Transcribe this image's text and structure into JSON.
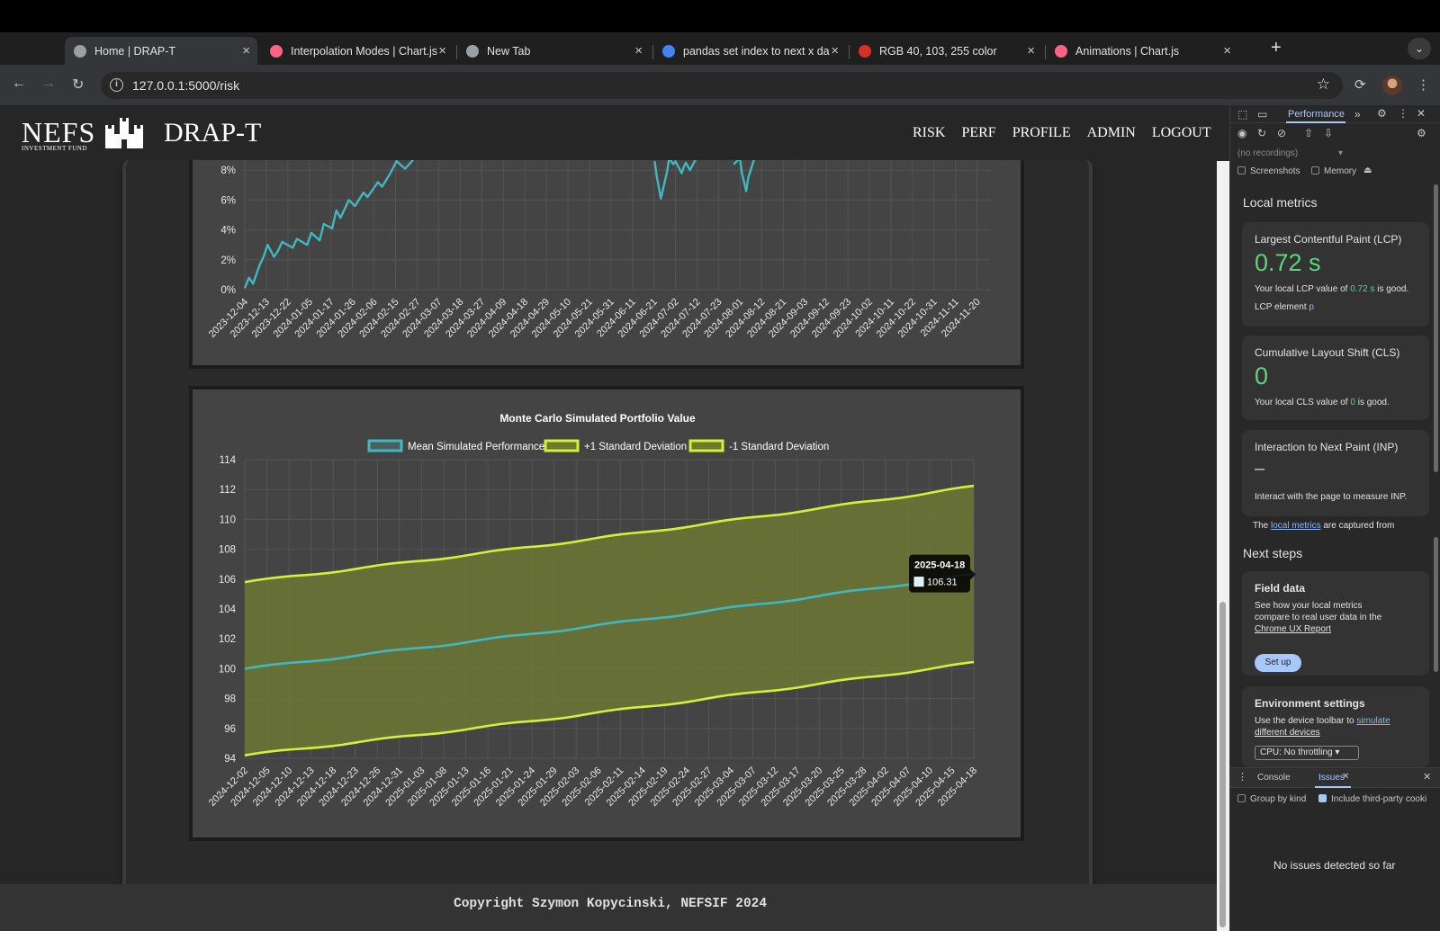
{
  "tabs": [
    {
      "title": "Home | DRAP-T",
      "fav": "#9aa0a6",
      "active": true
    },
    {
      "title": "Interpolation Modes | Chart.js",
      "fav": "#ff6384",
      "active": false
    },
    {
      "title": "New Tab",
      "fav": "#9aa0a6",
      "active": false
    },
    {
      "title": "pandas set index to next x da",
      "fav": "#4285f4",
      "active": false
    },
    {
      "title": "RGB 40, 103, 255 color",
      "fav": "#d93025",
      "active": false
    },
    {
      "title": "Animations | Chart.js",
      "fav": "#ff6384",
      "active": false
    }
  ],
  "toolbar": {
    "url": "127.0.0.1:5000/risk"
  },
  "site": {
    "logo_text": "NEFS",
    "logo_sub": "INVESTMENT FUND",
    "brand": "DRAP-T",
    "nav": [
      "RISK",
      "PERF",
      "PROFILE",
      "ADMIN",
      "LOGOUT"
    ],
    "footer": "Copyright Szymon Kopycinski, NEFSIF 2024"
  },
  "chart_data": [
    {
      "type": "line",
      "title": "",
      "y_tick_labels": [
        "0%",
        "2%",
        "4%",
        "6%",
        "8%"
      ],
      "x_tick_labels": [
        "2023-12-04",
        "2023-12-13",
        "2023-12-22",
        "2024-01-05",
        "2024-01-17",
        "2024-01-26",
        "2024-02-06",
        "2024-02-15",
        "2024-02-27",
        "2024-03-07",
        "2024-03-18",
        "2024-03-27",
        "2024-04-09",
        "2024-04-18",
        "2024-04-29",
        "2024-05-10",
        "2024-05-21",
        "2024-05-31",
        "2024-06-11",
        "2024-06-21",
        "2024-07-02",
        "2024-07-12",
        "2024-07-23",
        "2024-08-01",
        "2024-08-12",
        "2024-08-21",
        "2024-09-03",
        "2024-09-12",
        "2024-09-23",
        "2024-10-02",
        "2024-10-11",
        "2024-10-22",
        "2024-10-31",
        "2024-11-11",
        "2024-11-20"
      ],
      "color": "#3fb8c0",
      "grid": true,
      "series": [
        {
          "x": [
            "2023-12-04",
            "2023-12-06",
            "2023-12-08",
            "2023-12-11",
            "2023-12-13",
            "2023-12-15",
            "2023-12-18",
            "2023-12-20",
            "2023-12-22",
            "2023-12-27",
            "2023-12-29",
            "2024-01-03",
            "2024-01-05",
            "2024-01-09",
            "2024-01-11",
            "2024-01-15",
            "2024-01-17",
            "2024-01-19",
            "2024-01-23",
            "2024-01-26",
            "2024-01-30",
            "2024-02-01",
            "2024-02-06",
            "2024-02-08",
            "2024-02-12",
            "2024-02-15",
            "2024-02-19",
            "2024-02-23"
          ],
          "values": [
            0.1,
            0.8,
            0.4,
            1.6,
            2.2,
            3.0,
            2.2,
            2.6,
            3.2,
            2.8,
            3.4,
            3.0,
            3.8,
            3.3,
            4.4,
            4.1,
            5.3,
            4.8,
            6.0,
            5.6,
            6.5,
            6.2,
            7.2,
            6.9,
            7.8,
            8.6,
            8.1,
            8.7
          ]
        },
        {
          "x": [
            "2024-06-18",
            "2024-06-19",
            "2024-06-21",
            "2024-06-24",
            "2024-06-25",
            "2024-06-27",
            "2024-06-28",
            "2024-07-01",
            "2024-07-02",
            "2024-07-03",
            "2024-07-05",
            "2024-07-08"
          ],
          "values": [
            8.6,
            7.6,
            6.1,
            7.9,
            8.8,
            8.4,
            8.6,
            7.8,
            8.2,
            8.5,
            8.0,
            8.8
          ]
        },
        {
          "x": [
            "2024-07-26",
            "2024-07-29",
            "2024-07-30",
            "2024-08-01",
            "2024-08-02",
            "2024-08-05"
          ],
          "values": [
            8.4,
            8.8,
            7.8,
            6.6,
            7.5,
            8.8
          ]
        }
      ]
    },
    {
      "type": "area",
      "title": "Monte Carlo Simulated Portfolio Value",
      "legend_position": "top",
      "ylim": [
        94,
        114
      ],
      "y_ticks": [
        94,
        96,
        98,
        100,
        102,
        104,
        106,
        108,
        110,
        112,
        114
      ],
      "grid": true,
      "x_tick_labels": [
        "2024-12-02",
        "2024-12-05",
        "2024-12-10",
        "2024-12-13",
        "2024-12-18",
        "2024-12-23",
        "2024-12-26",
        "2024-12-31",
        "2025-01-03",
        "2025-01-08",
        "2025-01-13",
        "2025-01-16",
        "2025-01-21",
        "2025-01-24",
        "2025-01-29",
        "2025-02-03",
        "2025-02-06",
        "2025-02-11",
        "2025-02-14",
        "2025-02-19",
        "2025-02-24",
        "2025-02-27",
        "2025-03-04",
        "2025-03-07",
        "2025-03-12",
        "2025-03-17",
        "2025-03-20",
        "2025-03-25",
        "2025-03-28",
        "2025-04-02",
        "2025-04-07",
        "2025-04-10",
        "2025-04-15",
        "2025-04-18"
      ],
      "series": [
        {
          "name": "Mean Simulated Performance",
          "color": "#3fb8c0",
          "start": 100.0,
          "end": 106.31
        },
        {
          "name": "+1 Standard Deviation",
          "color": "#d4f03a",
          "start": 105.8,
          "end": 112.2
        },
        {
          "name": "-1 Standard Deviation",
          "color": "#d4f03a",
          "start": 94.2,
          "end": 100.4
        }
      ],
      "fill_color": "#6a7434",
      "tooltip": {
        "date": "2025-04-18",
        "value": "106.31"
      }
    }
  ],
  "devtools": {
    "panel": "Performance",
    "recordings": "(no recordings)",
    "screenshots": "Screenshots",
    "memory": "Memory",
    "local_metrics": "Local metrics",
    "lcp_title": "Largest Contentful Paint (LCP)",
    "lcp_value": "0.72 s",
    "lcp_desc_a": "Your local LCP value of ",
    "lcp_desc_v": "0.72 s",
    "lcp_desc_b": " is good.",
    "lcp_element": "LCP element",
    "lcp_element_v": "p",
    "cls_title": "Cumulative Layout Shift (CLS)",
    "cls_value": "0",
    "cls_desc_a": "Your local CLS value of ",
    "cls_desc_v": "0",
    "cls_desc_b": " is good.",
    "inp_title": "Interaction to Next Paint (INP)",
    "inp_value": "–",
    "inp_desc": "Interact with the page to measure INP.",
    "captured_a": "The ",
    "captured_link": "local metrics",
    "captured_b": " are captured from",
    "next_steps": "Next steps",
    "field_title": "Field data",
    "field_desc_1": "See how your local metrics",
    "field_desc_2": "compare to real user data in the",
    "field_link": "Chrome UX Report",
    "setup": "Set up",
    "env_title": "Environment settings",
    "env_desc_1": "Use the device toolbar to ",
    "env_link_1": "simulate",
    "env_link_2": "different devices",
    "cpu": "CPU: No throttling",
    "console_tab": "Console",
    "issues_tab": "Issues",
    "group_by_kind": "Group by kind",
    "third_party": "Include third-party cooki",
    "no_issues": "No issues detected so far"
  }
}
